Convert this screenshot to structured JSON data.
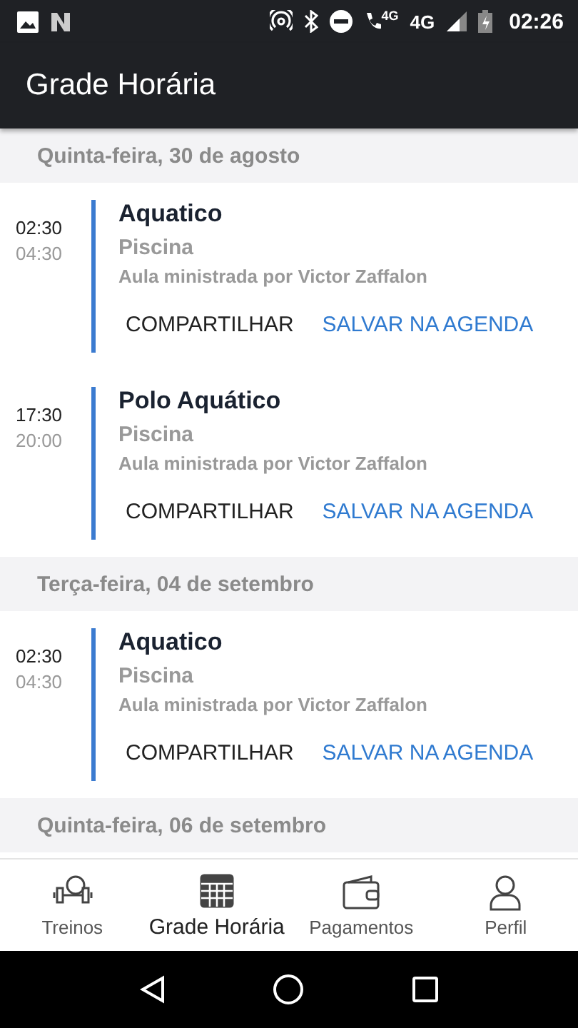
{
  "status_bar": {
    "call_badge": "4G",
    "network": "4G",
    "time": "02:26"
  },
  "app_bar": {
    "title": "Grade Horária"
  },
  "days": [
    {
      "date": "Quinta-feira, 30 de agosto",
      "events": [
        {
          "start": "02:30",
          "end": "04:30",
          "title": "Aquatico",
          "location": "Piscina",
          "instructor": "Aula ministrada por Victor Zaffalon",
          "share": "COMPARTILHAR",
          "save": "SALVAR NA AGENDA"
        },
        {
          "start": "17:30",
          "end": "20:00",
          "title": "Polo Aquático",
          "location": "Piscina",
          "instructor": "Aula ministrada por Victor Zaffalon",
          "share": "COMPARTILHAR",
          "save": "SALVAR NA AGENDA"
        }
      ]
    },
    {
      "date": "Terça-feira, 04 de setembro",
      "events": [
        {
          "start": "02:30",
          "end": "04:30",
          "title": "Aquatico",
          "location": "Piscina",
          "instructor": "Aula ministrada por Victor Zaffalon",
          "share": "COMPARTILHAR",
          "save": "SALVAR NA AGENDA"
        }
      ]
    },
    {
      "date": "Quinta-feira, 06 de setembro"
    }
  ],
  "bottom_nav": [
    {
      "kind": "workout",
      "label": "Treinos",
      "selected": false
    },
    {
      "kind": "schedule",
      "label": "Grade Horária",
      "selected": true
    },
    {
      "kind": "wallet",
      "label": "Pagamentos",
      "selected": false
    },
    {
      "kind": "profile",
      "label": "Perfil",
      "selected": false
    }
  ]
}
